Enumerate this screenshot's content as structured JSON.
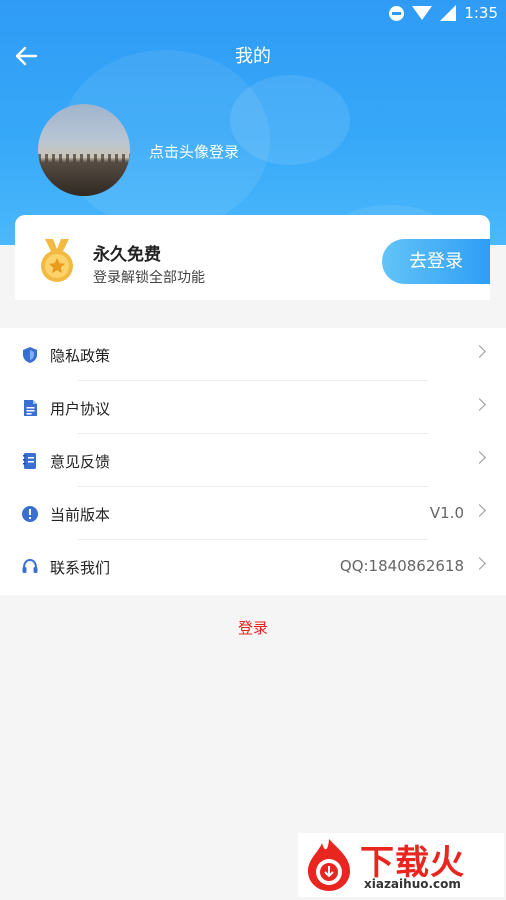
{
  "statusbar": {
    "time": "1:35"
  },
  "header": {
    "title": "我的"
  },
  "profile": {
    "login_hint": "点击头像登录"
  },
  "vip": {
    "title": "永久免费",
    "subtitle": "登录解锁全部功能",
    "button": "去登录"
  },
  "menu": {
    "items": [
      {
        "label": "隐私政策",
        "value": "",
        "icon": "shield-icon"
      },
      {
        "label": "用户协议",
        "value": "",
        "icon": "document-icon"
      },
      {
        "label": "意见反馈",
        "value": "",
        "icon": "notebook-icon"
      },
      {
        "label": "当前版本",
        "value": "V1.0",
        "icon": "info-icon"
      },
      {
        "label": "联系我们",
        "value": "QQ:1840862618",
        "icon": "headset-icon"
      }
    ]
  },
  "footer": {
    "login": "登录"
  },
  "watermark": {
    "title": "下载火",
    "url": "xiazaihuo.com"
  },
  "colors": {
    "primary": "#2f9bf5",
    "accent_red": "#e8251f",
    "medal_gold": "#f4b942"
  }
}
